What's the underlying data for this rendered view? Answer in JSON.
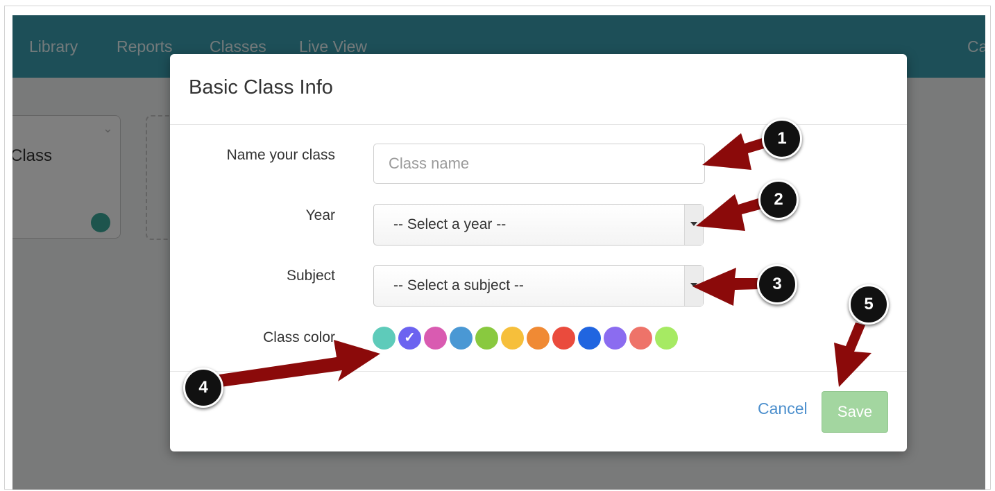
{
  "nav": {
    "items": [
      "Library",
      "Reports",
      "Classes",
      "Live View"
    ],
    "right_partial": "Ca"
  },
  "background_card": {
    "title": "Class"
  },
  "modal": {
    "title": "Basic Class Info",
    "fields": {
      "name_label": "Name your class",
      "name_placeholder": "Class name",
      "name_value": "",
      "year_label": "Year",
      "year_selected": "-- Select a year --",
      "subject_label": "Subject",
      "subject_selected": "-- Select a subject --",
      "color_label": "Class color"
    },
    "colors": [
      "#5ecbba",
      "#6c63f0",
      "#d95bb1",
      "#4a98d4",
      "#89c93f",
      "#f6bf3b",
      "#f08a34",
      "#ea4b3d",
      "#2065e0",
      "#8b6cf0",
      "#ee7369",
      "#a6ea63"
    ],
    "selected_color_index": 1,
    "check_glyph": "✓",
    "cancel_label": "Cancel",
    "save_label": "Save"
  },
  "annotations": {
    "callouts": [
      "1",
      "2",
      "3",
      "4",
      "5"
    ],
    "arrow_color": "#8b0a0a"
  }
}
